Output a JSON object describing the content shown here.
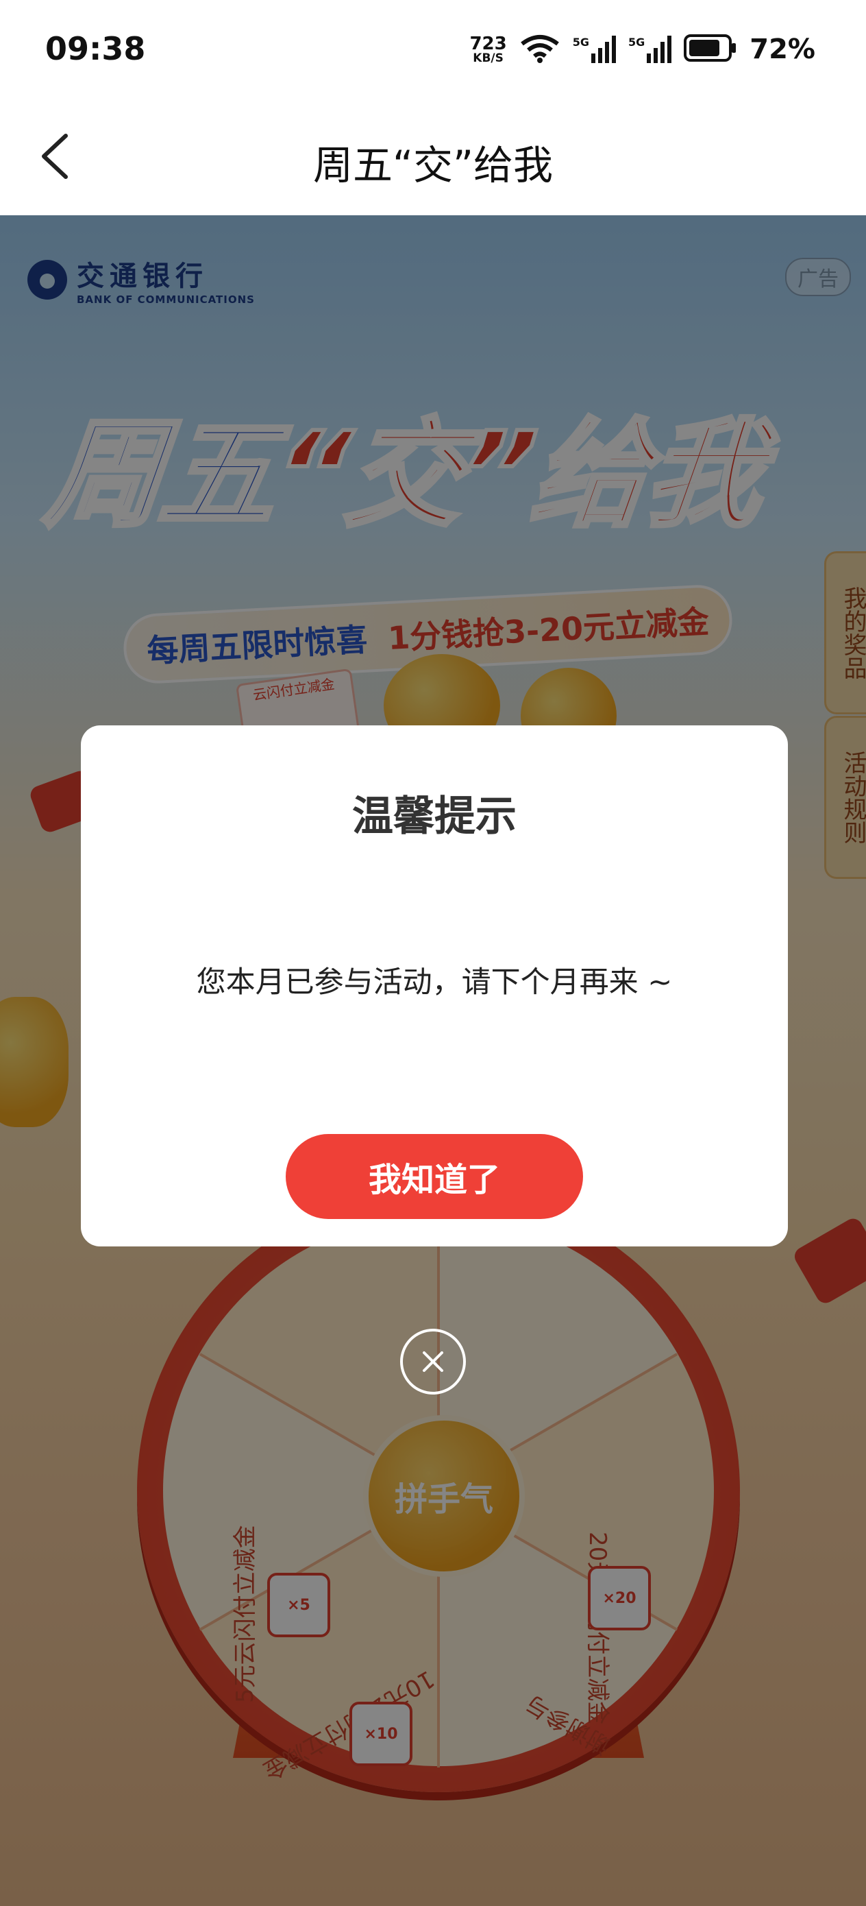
{
  "status_bar": {
    "time": "09:38",
    "net_speed_value": "723",
    "net_speed_unit": "KB/S",
    "signal1": "5G",
    "signal2": "5G",
    "battery": "72%"
  },
  "nav": {
    "title": "周五“交”给我"
  },
  "promo": {
    "bank_name_cn": "交通银行",
    "bank_name_en": "BANK OF COMMUNICATIONS",
    "ad_tag": "广告",
    "title_blue": "周五",
    "title_red": "“交”给我",
    "subtitle_left": "每周五限时惊喜",
    "subtitle_right": "1分钱抢3-20元立减金",
    "coupon_text": "云闪付立减金",
    "side_tabs": {
      "my_prizes": "我的奖品",
      "rules": "活动规则"
    },
    "wheel": {
      "hub_text": "拼手气",
      "segments": [
        "20元云闪付立减金",
        "谢谢参与",
        "10元云闪付立减金",
        "5元云闪付立减金"
      ],
      "coupon_values": [
        "×20",
        "×10",
        "×5"
      ]
    }
  },
  "dialog": {
    "title": "温馨提示",
    "message": "您本月已参与活动，请下个月再来 ~",
    "confirm_label": "我知道了"
  },
  "colors": {
    "accent": "#ef4037",
    "brand_blue": "#2b57c8"
  }
}
